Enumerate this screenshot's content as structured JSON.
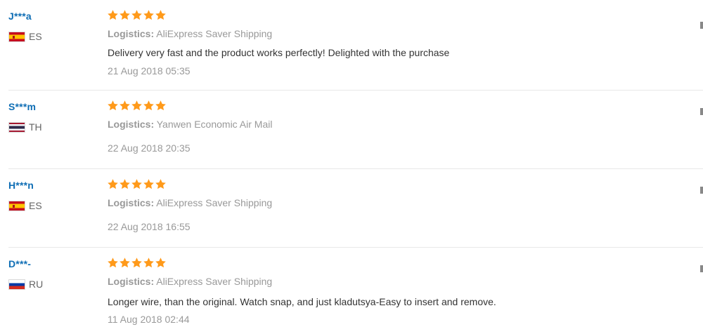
{
  "colors": {
    "username": "#0f6eb5",
    "star": "#ff9a1a",
    "muted": "#999999",
    "text": "#333333",
    "divider": "#e8e8e8"
  },
  "reviews": [
    {
      "user": "J***a",
      "country_code": "ES",
      "flag_icon": "spain-flag-icon",
      "rating": 5,
      "logistics_label": "Logistics:",
      "logistics_value": " AliExpress Saver Shipping",
      "comment": "Delivery very fast and the product works perfectly! Delighted with the purchase",
      "date": "21 Aug 2018 05:35"
    },
    {
      "user": "S***m",
      "country_code": "TH",
      "flag_icon": "thailand-flag-icon",
      "rating": 5,
      "logistics_label": "Logistics:",
      "logistics_value": " Yanwen Economic Air Mail",
      "comment": "",
      "date": "22 Aug 2018 20:35"
    },
    {
      "user": "H***n",
      "country_code": "ES",
      "flag_icon": "spain-flag-icon",
      "rating": 5,
      "logistics_label": "Logistics:",
      "logistics_value": " AliExpress Saver Shipping",
      "comment": "",
      "date": "22 Aug 2018 16:55"
    },
    {
      "user": "D***-",
      "country_code": "RU",
      "flag_icon": "russia-flag-icon",
      "rating": 5,
      "logistics_label": "Logistics:",
      "logistics_value": " AliExpress Saver Shipping",
      "comment": "Longer wire, than the original. Watch snap, and just kladutsya-Easy to insert and remove.",
      "date": "11 Aug 2018 02:44"
    }
  ]
}
